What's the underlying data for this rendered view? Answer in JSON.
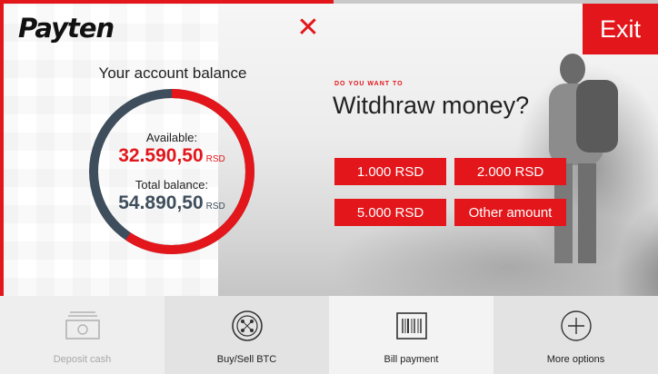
{
  "header": {
    "logo_text": "Payten",
    "close_icon": "close-icon",
    "exit_label": "Exit"
  },
  "balance": {
    "title": "Your account balance",
    "available_label": "Available:",
    "available_value": "32.590,50",
    "total_label": "Total balance:",
    "total_value": "54.890,50",
    "currency": "RSD",
    "available_fraction": 0.594
  },
  "withdraw": {
    "kicker": "DO YOU WANT TO",
    "question": "Witdhraw money?",
    "amounts": [
      "1.000 RSD",
      "2.000 RSD",
      "5.000 RSD",
      "Other amount"
    ]
  },
  "bottom": {
    "tiles": [
      {
        "label": "Deposit cash",
        "icon": "cash-icon",
        "enabled": false
      },
      {
        "label": "Buy/Sell BTC",
        "icon": "bitcoin-icon",
        "enabled": true
      },
      {
        "label": "Bill payment",
        "icon": "barcode-icon",
        "enabled": true
      },
      {
        "label": "More options",
        "icon": "plus-icon",
        "enabled": true
      }
    ]
  },
  "colors": {
    "accent": "#e3161b",
    "ring_total": "#3f4e5c"
  }
}
